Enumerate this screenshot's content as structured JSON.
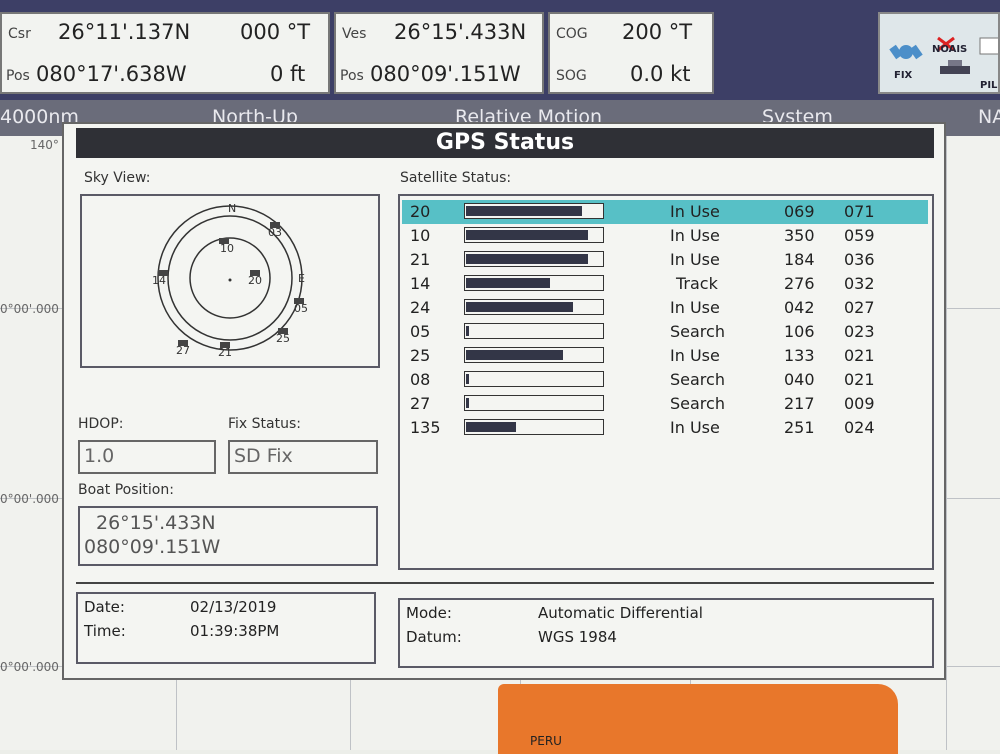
{
  "top": {
    "csr": {
      "label": "Csr",
      "lat": "26°11'.137N",
      "bearing": "000 °T",
      "pos_label": "Pos",
      "lon": "080°17'.638W",
      "depth": "0 ft"
    },
    "ves": {
      "label": "Ves",
      "lat": "26°15'.433N",
      "pos_label": "Pos",
      "lon": "080°09'.151W"
    },
    "cog": {
      "label": "COG",
      "value": "200 °T"
    },
    "sog": {
      "label": "SOG",
      "value": "0.0 kt"
    },
    "tools": {
      "fix": "FIX",
      "noais": "NOAIS",
      "pil": "PIL"
    }
  },
  "chart_strip": {
    "range": "4000nm",
    "orientation": "North-Up",
    "motion": "Relative Motion",
    "system": "System",
    "na": "NA"
  },
  "map": {
    "lat_labels": [
      "140°",
      "0°00'.000",
      "0°00'.000",
      "0°00'.000"
    ],
    "country": "PERU"
  },
  "dialog": {
    "title": "GPS Status",
    "sky_view_label": "Sky View:",
    "satellite_status_label": "Satellite Status:",
    "hdop_label": "HDOP:",
    "hdop_value": "1.0",
    "fix_status_label": "Fix Status:",
    "fix_status_value": "SD Fix",
    "boat_position_label": "Boat Position:",
    "boat_lat": "26°15'.433N",
    "boat_lon": "080°09'.151W",
    "date_label": "Date:",
    "date_value": "02/13/2019",
    "time_label": "Time:",
    "time_value": "01:39:38PM",
    "mode_label": "Mode:",
    "mode_value": "Automatic Differential",
    "datum_label": "Datum:",
    "datum_value": "WGS 1984",
    "sky": {
      "north": "N",
      "east": "E",
      "sats": [
        "10",
        "14",
        "20",
        "05",
        "25",
        "21",
        "27",
        "03"
      ]
    },
    "satellites": [
      {
        "prn": "20",
        "strength": 0.85,
        "status": "In Use",
        "azimuth": "069",
        "elevation": "071",
        "selected": true
      },
      {
        "prn": "10",
        "strength": 0.9,
        "status": "In Use",
        "azimuth": "350",
        "elevation": "059"
      },
      {
        "prn": "21",
        "strength": 0.9,
        "status": "In Use",
        "azimuth": "184",
        "elevation": "036"
      },
      {
        "prn": "14",
        "strength": 0.62,
        "status": "Track",
        "azimuth": "276",
        "elevation": "032"
      },
      {
        "prn": "24",
        "strength": 0.79,
        "status": "In Use",
        "azimuth": "042",
        "elevation": "027"
      },
      {
        "prn": "05",
        "strength": 0.02,
        "status": "Search",
        "azimuth": "106",
        "elevation": "023"
      },
      {
        "prn": "25",
        "strength": 0.71,
        "status": "In Use",
        "azimuth": "133",
        "elevation": "021"
      },
      {
        "prn": "08",
        "strength": 0.02,
        "status": "Search",
        "azimuth": "040",
        "elevation": "021"
      },
      {
        "prn": "27",
        "strength": 0.02,
        "status": "Search",
        "azimuth": "217",
        "elevation": "009"
      },
      {
        "prn": "135",
        "strength": 0.37,
        "status": "In Use",
        "azimuth": "251",
        "elevation": "024"
      }
    ]
  }
}
